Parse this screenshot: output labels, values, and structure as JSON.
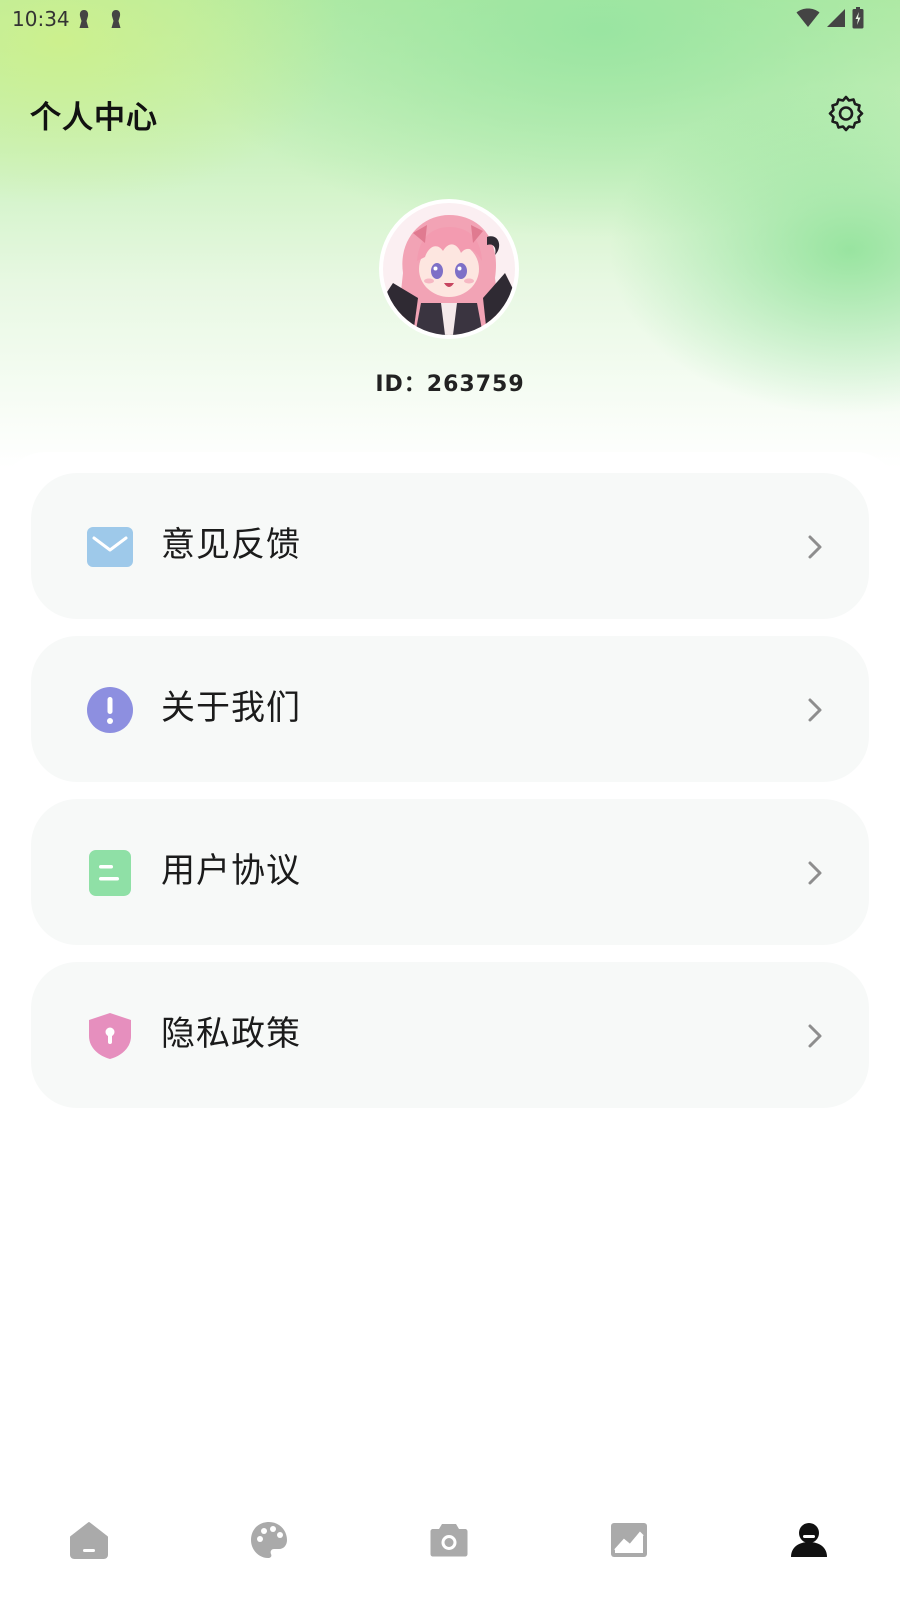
{
  "status_bar": {
    "time": "10:34"
  },
  "header": {
    "title": "个人中心",
    "settings_icon": "gear-icon"
  },
  "profile": {
    "user_id_text": "ID：263759",
    "avatar": "anime-girl-avatar"
  },
  "menu": {
    "items": [
      {
        "label": "意见反馈",
        "icon": "mail-icon",
        "icon_color": "#9ec9ea"
      },
      {
        "label": "关于我们",
        "icon": "info-exclamation-icon",
        "icon_color": "#8d8fe0"
      },
      {
        "label": "用户协议",
        "icon": "document-icon",
        "icon_color": "#8fe0a6"
      },
      {
        "label": "隐私政策",
        "icon": "shield-lock-icon",
        "icon_color": "#e68fbe"
      }
    ]
  },
  "bottom_nav": {
    "items": [
      {
        "icon": "home-icon",
        "active": false
      },
      {
        "icon": "palette-icon",
        "active": false
      },
      {
        "icon": "camera-icon",
        "active": false
      },
      {
        "icon": "gallery-icon",
        "active": false
      },
      {
        "icon": "profile-icon",
        "active": true
      }
    ]
  },
  "colors": {
    "active_nav": "#111111",
    "inactive_nav": "#aaaaaa",
    "card_bg": "#f7f9f8",
    "hero_green": "#9ee6a4"
  }
}
